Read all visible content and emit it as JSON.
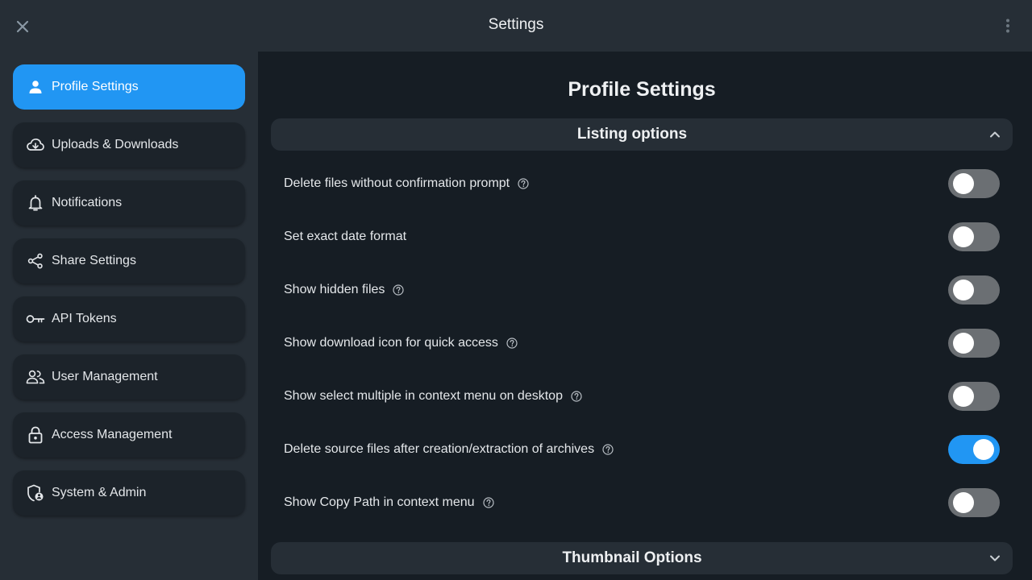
{
  "header": {
    "title": "Settings"
  },
  "sidebar": {
    "items": [
      {
        "label": "Profile Settings",
        "icon": "person-icon",
        "active": true
      },
      {
        "label": "Uploads & Downloads",
        "icon": "cloud-sync-icon",
        "active": false
      },
      {
        "label": "Notifications",
        "icon": "bell-icon",
        "active": false
      },
      {
        "label": "Share Settings",
        "icon": "share-icon",
        "active": false
      },
      {
        "label": "API Tokens",
        "icon": "key-icon",
        "active": false
      },
      {
        "label": "User Management",
        "icon": "users-icon",
        "active": false
      },
      {
        "label": "Access Management",
        "icon": "lock-icon",
        "active": false
      },
      {
        "label": "System & Admin",
        "icon": "shield-admin-icon",
        "active": false
      }
    ]
  },
  "main": {
    "page_title": "Profile Settings",
    "sections": [
      {
        "title": "Listing options",
        "expanded": true
      },
      {
        "title": "Thumbnail Options",
        "expanded": false
      }
    ],
    "options": [
      {
        "label": "Delete files without confirmation prompt",
        "help": true,
        "enabled": false
      },
      {
        "label": "Set exact date format",
        "help": false,
        "enabled": false
      },
      {
        "label": "Show hidden files",
        "help": true,
        "enabled": false
      },
      {
        "label": "Show download icon for quick access",
        "help": true,
        "enabled": false
      },
      {
        "label": "Show select multiple in context menu on desktop",
        "help": true,
        "enabled": false
      },
      {
        "label": "Delete source files after creation/extraction of archives",
        "help": true,
        "enabled": true
      },
      {
        "label": "Show Copy Path in context menu",
        "help": true,
        "enabled": false
      }
    ]
  },
  "colors": {
    "accent": "#2196f3",
    "background": "#161d24",
    "sidebar": "#262e36",
    "toggle_off": "#6b6f73"
  }
}
